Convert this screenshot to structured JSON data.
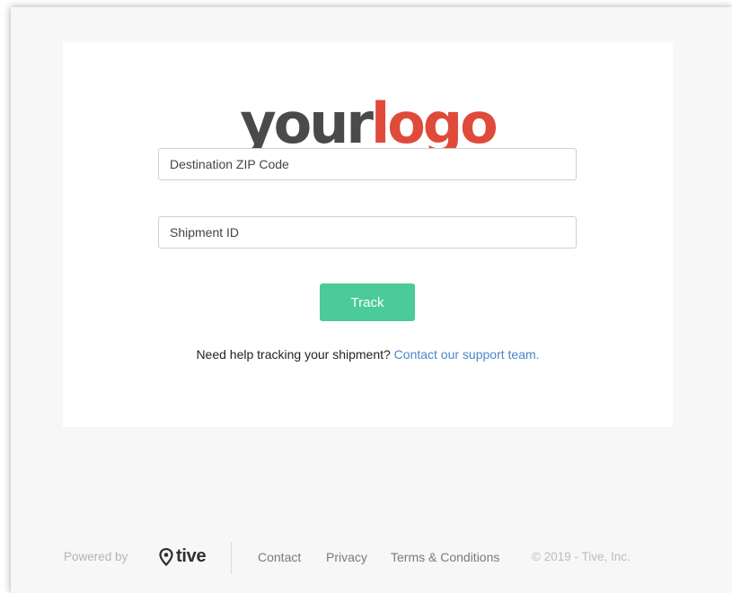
{
  "logo": {
    "word1": "your",
    "word2": "logo",
    "color_dark": "#4a4a4d",
    "color_accent": "#e04a3a"
  },
  "form": {
    "zip_placeholder": "Destination ZIP Code",
    "zip_value": "",
    "shipment_placeholder": "Shipment ID",
    "shipment_value": "",
    "track_label": "Track",
    "track_color": "#4bcb98"
  },
  "help": {
    "text": "Need help tracking your shipment?",
    "link_text": "Contact our support team."
  },
  "footer": {
    "powered_by": "Powered by",
    "brand": "tive",
    "brand_icon": "location-pin-icon",
    "links": [
      "Contact",
      "Privacy",
      "Terms & Conditions"
    ],
    "copyright": "© 2019 - Tive, Inc."
  }
}
